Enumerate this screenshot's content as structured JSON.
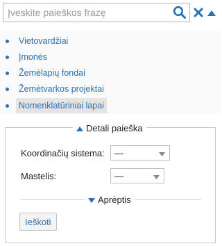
{
  "search": {
    "placeholder": "Įveskite paieškos frazę",
    "value": ""
  },
  "categories": [
    {
      "label": "Vietovardžiai",
      "selected": false
    },
    {
      "label": "Įmonės",
      "selected": false
    },
    {
      "label": "Žemėlapių fondai",
      "selected": false
    },
    {
      "label": "Žemėtvarkos projektai",
      "selected": false
    },
    {
      "label": "Nomenklatūriniai lapai",
      "selected": true
    }
  ],
  "detail": {
    "title": "Detali paieška",
    "coord_label": "Koordinačių sistema:",
    "coord_value": "—",
    "scale_label": "Mastelis:",
    "scale_value": "—",
    "scope_label": "Aprėptis",
    "submit_label": "Ieškoti"
  },
  "colors": {
    "accent": "#2a6fb3",
    "selected_bg": "#e4e4e4",
    "border": "#c8c8c8"
  },
  "icons": {
    "search": "magnifier-icon",
    "close": "close-icon",
    "collapse": "caret-up-icon"
  }
}
